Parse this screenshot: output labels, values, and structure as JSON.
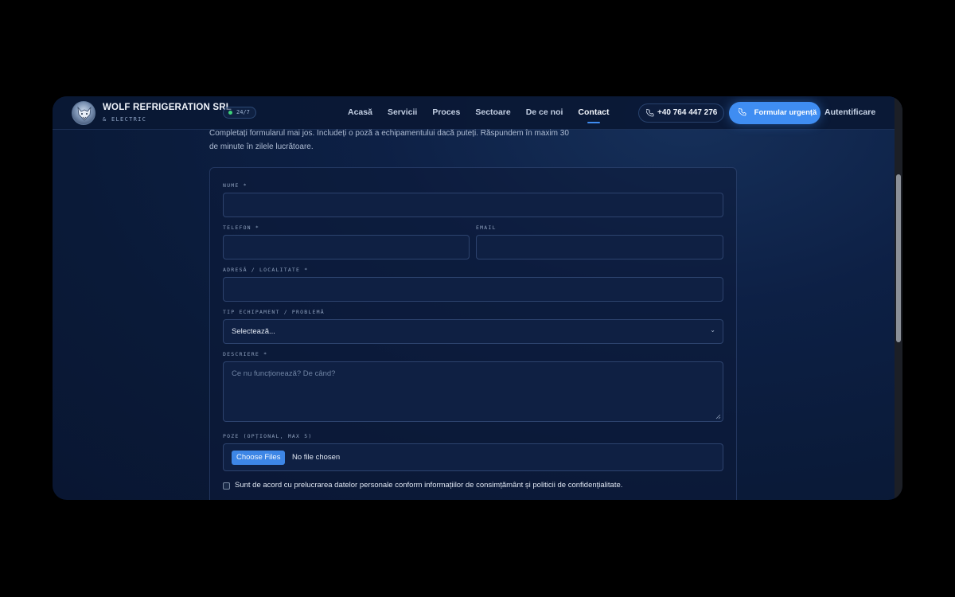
{
  "brand": {
    "name": "WOLF REFRIGERATION SRL",
    "sub": "& ELECTRIC",
    "badge": "24/7"
  },
  "nav": {
    "items": [
      "Acasă",
      "Servicii",
      "Proces",
      "Sectoare",
      "De ce noi",
      "Contact"
    ],
    "active": "Contact"
  },
  "header": {
    "phone": "+40 764 447 276",
    "urgent_label": "Formular urgență",
    "auth_label": "Autentificare"
  },
  "intro": {
    "line1": "Completați formularul mai jos. Includeți o poză a echipamentului dacă puteți. Răspundem în maxim 30",
    "line2": "de minute în zilele lucrătoare."
  },
  "form": {
    "name_label": "NUME *",
    "phone_label": "TELEFON *",
    "email_label": "EMAIL",
    "address_label": "ADRESĂ / LOCALITATE *",
    "equipment_label": "TIP ECHIPAMENT / PROBLEMĂ",
    "equipment_selected": "Selectează...",
    "description_label": "DESCRIERE *",
    "description_placeholder": "Ce nu funcționează? De când?",
    "photos_label": "POZE (OPȚIONAL, MAX 5)",
    "file_button": "Choose Files",
    "file_status": "No file chosen",
    "consent_text": "Sunt de acord cu prelucrarea datelor personale conform informațiilor de consimțământ și politicii de confidențialitate."
  },
  "colors": {
    "accent": "#3f8df2",
    "background": "#0a1a38",
    "online": "#3ed27a"
  }
}
